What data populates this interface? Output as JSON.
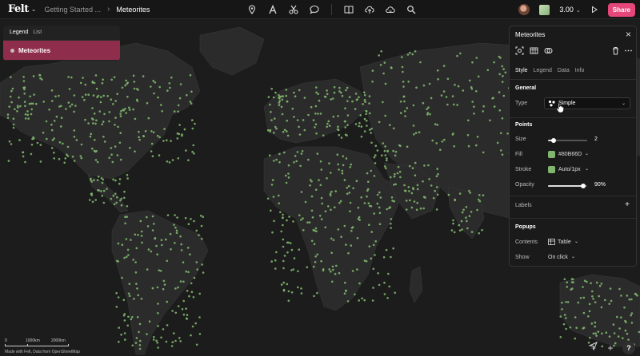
{
  "topbar": {
    "logo": "Felt",
    "logo_chevron": "⌄",
    "breadcrumb_project": "Getting Started ...",
    "breadcrumb_separator": "›",
    "breadcrumb_map": "Meteorites",
    "tools": [
      "pin-icon",
      "text-icon",
      "scissors-icon",
      "comment-icon",
      "book-icon",
      "upload-icon",
      "cloud-icon",
      "search-icon"
    ],
    "version": "3.00",
    "share_label": "Share",
    "accent_color": "#e5477a"
  },
  "legend_panel": {
    "tabs": [
      "Legend",
      "List"
    ],
    "active_tab": "Legend",
    "layer_name": "Meteorites",
    "row_color": "#8f2d4c"
  },
  "style_panel": {
    "title": "Meteorites",
    "tabs": [
      "Style",
      "Legend",
      "Data",
      "Info"
    ],
    "active_tab": "Style",
    "general": {
      "section": "General",
      "type_label": "Type",
      "type_value": "Simple"
    },
    "points": {
      "section": "Points",
      "size_label": "Size",
      "size_value": "2",
      "size_fraction": 0.15,
      "fill_label": "Fill",
      "fill_value": "#80B66D",
      "stroke_label": "Stroke",
      "stroke_value": "Auto/1px",
      "opacity_label": "Opacity",
      "opacity_value": "90%",
      "opacity_fraction": 0.9
    },
    "labels": {
      "label": "Labels"
    },
    "popups": {
      "section": "Popups",
      "contents_label": "Contents",
      "contents_value": "Table",
      "show_label": "Show",
      "show_value": "On click"
    }
  },
  "map": {
    "point_color": "#80b66d",
    "scale_labels": [
      "0",
      "1000km",
      "2000km"
    ],
    "attribution": "Made with Felt, Data from OpenStreetMap"
  },
  "controls": {
    "help": "?"
  }
}
